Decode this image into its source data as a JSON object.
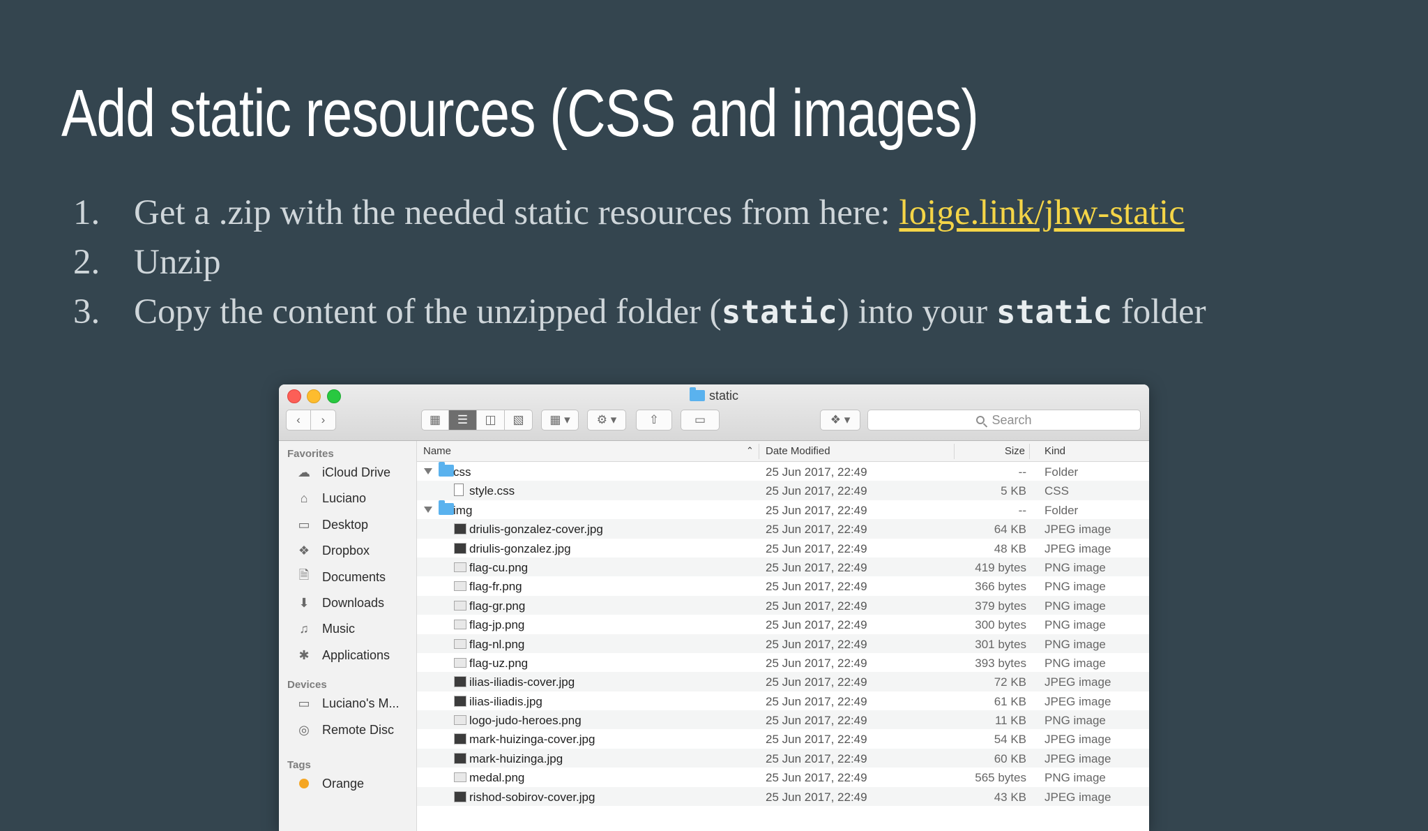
{
  "slide": {
    "title": "Add static resources (CSS and images)",
    "steps": [
      {
        "num": "1.",
        "text": "Get a .zip with the needed static resources from here: ",
        "link": "loige.link/jhw-static"
      },
      {
        "num": "2.",
        "text": "Unzip"
      },
      {
        "num": "3.",
        "pre": "Copy the content of the unzipped folder (",
        "code1": "static",
        "mid": ") into your ",
        "code2": "static",
        "post": " folder"
      }
    ]
  },
  "finder": {
    "window_title": "static",
    "search_placeholder": "Search",
    "sidebar": {
      "favorites_label": "Favorites",
      "favorites": [
        {
          "label": "iCloud Drive",
          "icon": "cloud-icon"
        },
        {
          "label": "Luciano",
          "icon": "home-icon"
        },
        {
          "label": "Desktop",
          "icon": "desktop-icon"
        },
        {
          "label": "Dropbox",
          "icon": "dropbox-icon"
        },
        {
          "label": "Documents",
          "icon": "documents-icon"
        },
        {
          "label": "Downloads",
          "icon": "downloads-icon"
        },
        {
          "label": "Music",
          "icon": "music-icon"
        },
        {
          "label": "Applications",
          "icon": "applications-icon"
        }
      ],
      "devices_label": "Devices",
      "devices": [
        {
          "label": "Luciano's M...",
          "icon": "laptop-icon"
        },
        {
          "label": "Remote Disc",
          "icon": "disc-icon"
        }
      ],
      "tags_label": "Tags",
      "tags": [
        {
          "label": "Orange",
          "color": "#f5a623"
        }
      ]
    },
    "columns": {
      "name": "Name",
      "date": "Date Modified",
      "size": "Size",
      "kind": "Kind"
    },
    "rows": [
      {
        "name": "css",
        "date": "25 Jun 2017, 22:49",
        "size": "--",
        "kind": "Folder",
        "level": 0,
        "type": "folder"
      },
      {
        "name": "style.css",
        "date": "25 Jun 2017, 22:49",
        "size": "5 KB",
        "kind": "CSS",
        "level": 1,
        "type": "doc"
      },
      {
        "name": "img",
        "date": "25 Jun 2017, 22:49",
        "size": "--",
        "kind": "Folder",
        "level": 0,
        "type": "folder"
      },
      {
        "name": "driulis-gonzalez-cover.jpg",
        "date": "25 Jun 2017, 22:49",
        "size": "64 KB",
        "kind": "JPEG image",
        "level": 1,
        "type": "img"
      },
      {
        "name": "driulis-gonzalez.jpg",
        "date": "25 Jun 2017, 22:49",
        "size": "48 KB",
        "kind": "JPEG image",
        "level": 1,
        "type": "img"
      },
      {
        "name": "flag-cu.png",
        "date": "25 Jun 2017, 22:49",
        "size": "419 bytes",
        "kind": "PNG image",
        "level": 1,
        "type": "png"
      },
      {
        "name": "flag-fr.png",
        "date": "25 Jun 2017, 22:49",
        "size": "366 bytes",
        "kind": "PNG image",
        "level": 1,
        "type": "png"
      },
      {
        "name": "flag-gr.png",
        "date": "25 Jun 2017, 22:49",
        "size": "379 bytes",
        "kind": "PNG image",
        "level": 1,
        "type": "png"
      },
      {
        "name": "flag-jp.png",
        "date": "25 Jun 2017, 22:49",
        "size": "300 bytes",
        "kind": "PNG image",
        "level": 1,
        "type": "png"
      },
      {
        "name": "flag-nl.png",
        "date": "25 Jun 2017, 22:49",
        "size": "301 bytes",
        "kind": "PNG image",
        "level": 1,
        "type": "png"
      },
      {
        "name": "flag-uz.png",
        "date": "25 Jun 2017, 22:49",
        "size": "393 bytes",
        "kind": "PNG image",
        "level": 1,
        "type": "png"
      },
      {
        "name": "ilias-iliadis-cover.jpg",
        "date": "25 Jun 2017, 22:49",
        "size": "72 KB",
        "kind": "JPEG image",
        "level": 1,
        "type": "img"
      },
      {
        "name": "ilias-iliadis.jpg",
        "date": "25 Jun 2017, 22:49",
        "size": "61 KB",
        "kind": "JPEG image",
        "level": 1,
        "type": "img"
      },
      {
        "name": "logo-judo-heroes.png",
        "date": "25 Jun 2017, 22:49",
        "size": "11 KB",
        "kind": "PNG image",
        "level": 1,
        "type": "png"
      },
      {
        "name": "mark-huizinga-cover.jpg",
        "date": "25 Jun 2017, 22:49",
        "size": "54 KB",
        "kind": "JPEG image",
        "level": 1,
        "type": "img"
      },
      {
        "name": "mark-huizinga.jpg",
        "date": "25 Jun 2017, 22:49",
        "size": "60 KB",
        "kind": "JPEG image",
        "level": 1,
        "type": "img"
      },
      {
        "name": "medal.png",
        "date": "25 Jun 2017, 22:49",
        "size": "565 bytes",
        "kind": "PNG image",
        "level": 1,
        "type": "png"
      },
      {
        "name": "rishod-sobirov-cover.jpg",
        "date": "25 Jun 2017, 22:49",
        "size": "43 KB",
        "kind": "JPEG image",
        "level": 1,
        "type": "img"
      }
    ]
  }
}
